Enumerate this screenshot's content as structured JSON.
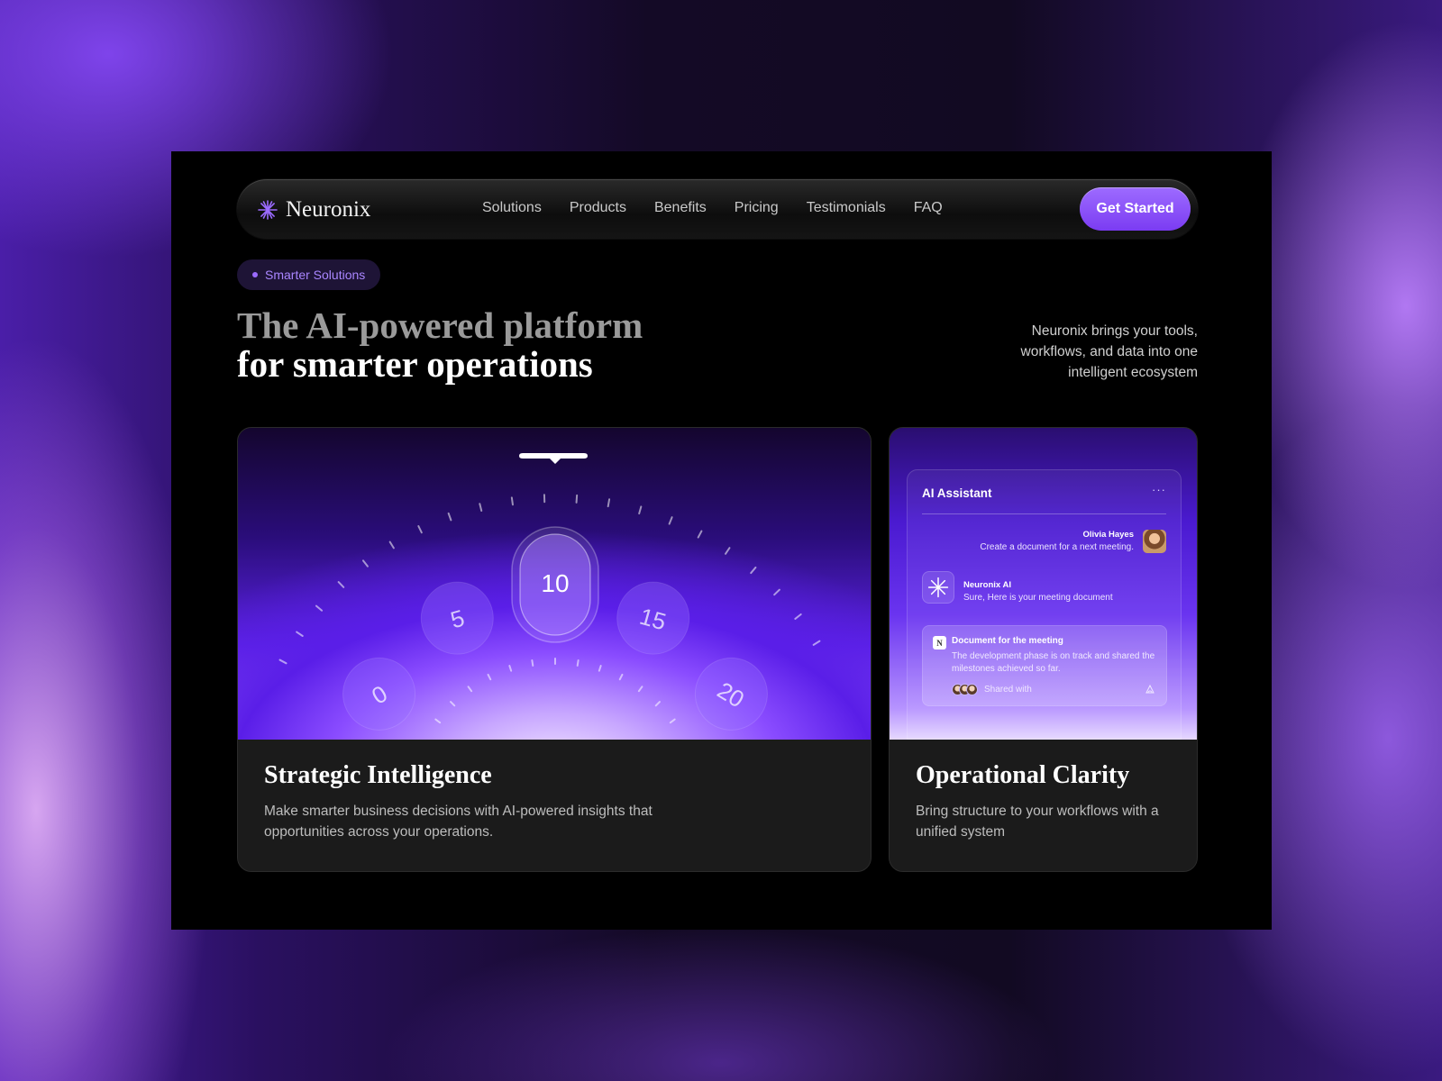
{
  "brand": {
    "name": "Neuronix"
  },
  "nav": {
    "items": [
      "Solutions",
      "Products",
      "Benefits",
      "Pricing",
      "Testimonials",
      "FAQ"
    ],
    "cta_label": "Get Started"
  },
  "badge": {
    "label": "Smarter Solutions"
  },
  "hero": {
    "title_line1": "The AI-powered platform",
    "title_line2": "for smarter operations",
    "lead": "Neuronix brings your tools, workflows, and data into one intelligent ecosystem"
  },
  "cards": [
    {
      "title": "Strategic Intelligence",
      "text": "Make smarter business decisions with AI-powered insights that opportunities across your operations.",
      "dial": {
        "values": [
          "0",
          "5",
          "10",
          "15",
          "20"
        ],
        "selected": "10"
      }
    },
    {
      "title": "Operational Clarity",
      "text": "Bring structure to your workflows with a unified system",
      "assistant": {
        "title": "AI Assistant",
        "menu_icon": "ellipsis-icon",
        "user_name": "Olivia Hayes",
        "user_message": "Create a document for a next meeting.",
        "ai_name": "Neuronix AI",
        "ai_message": "Sure, Here is your meeting document",
        "doc_title": "Document for the meeting",
        "doc_text": "The development phase is on track and shared the milestones achieved so far.",
        "shared_label": "Shared with"
      }
    }
  ],
  "colors": {
    "accent": "#8b55ff",
    "accent_light": "#a986ff",
    "frame_bg": "#000000",
    "card_bg": "#1b1b1b"
  }
}
